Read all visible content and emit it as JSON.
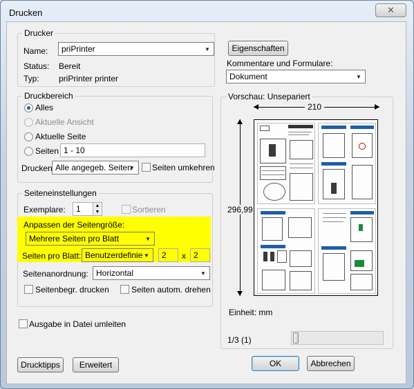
{
  "window": {
    "title": "Drucken",
    "close_glyph": "✕"
  },
  "printer": {
    "group_label": "Drucker",
    "name_label": "Name:",
    "name_value": "priPrinter",
    "status_label": "Status:",
    "status_value": "Bereit",
    "type_label": "Typ:",
    "type_value": "priPrinter printer",
    "properties_button": "Eigenschaften",
    "comments_label": "Kommentare und Formulare:",
    "comments_value": "Dokument"
  },
  "range": {
    "group_label": "Druckbereich",
    "all": "Alles",
    "current_view": "Aktuelle Ansicht",
    "current_page": "Aktuelle Seite",
    "pages": "Seiten",
    "pages_value": "1 - 10",
    "print_label": "Drucken:",
    "print_value": "Alle angegeb. Seiten",
    "reverse": "Seiten umkehren"
  },
  "page_setup": {
    "group_label": "Seiteneinstellungen",
    "copies_label": "Exemplare:",
    "copies_value": "1",
    "collate": "Sortieren",
    "fit_label": "Anpassen der Seitengröße:",
    "fit_value": "Mehrere Seiten pro Blatt",
    "per_sheet_label": "Seiten pro Blatt:",
    "per_sheet_value": "Benutzerdefiniert",
    "cols": "2",
    "times": "x",
    "rows": "2",
    "order_label": "Seitenanordnung:",
    "order_value": "Horizontal",
    "borders": "Seitenbegr. drucken",
    "autorotate": "Seiten autom. drehen"
  },
  "output_to_file": "Ausgabe in Datei umleiten",
  "preview": {
    "label": "Vorschau: Unsepariert",
    "width": "210",
    "height": "296,99",
    "unit": "Einheit: mm",
    "page_counter": "1/3 (1)"
  },
  "buttons": {
    "tips": "Drucktipps",
    "advanced": "Erweitert",
    "ok": "OK",
    "cancel": "Abbrechen"
  },
  "colors": {
    "highlight": "#ffff00",
    "accent": "#2a5d9a"
  }
}
